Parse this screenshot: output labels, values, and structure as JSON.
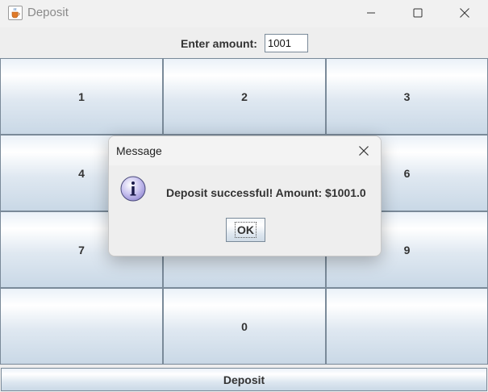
{
  "window": {
    "title": "Deposit",
    "app_icon": "java-cup-icon",
    "controls": [
      "minimize-icon",
      "maximize-icon",
      "close-icon"
    ]
  },
  "form": {
    "label": "Enter amount:",
    "amount_value": "1001"
  },
  "keypad": {
    "keys": [
      "1",
      "2",
      "3",
      "4",
      "",
      "6",
      "7",
      "",
      "9",
      "",
      "0",
      ""
    ]
  },
  "deposit_button": {
    "label": "Deposit"
  },
  "dialog": {
    "title": "Message",
    "icon": "info-icon",
    "message": "Deposit successful! Amount: $1001.0",
    "ok_label": "OK"
  },
  "colors": {
    "button_border": "#7a8a99",
    "button_gradient_top": "#ffffff",
    "button_gradient_bottom": "#c9d8e6",
    "info_icon_fill": "#c9c3ef"
  }
}
